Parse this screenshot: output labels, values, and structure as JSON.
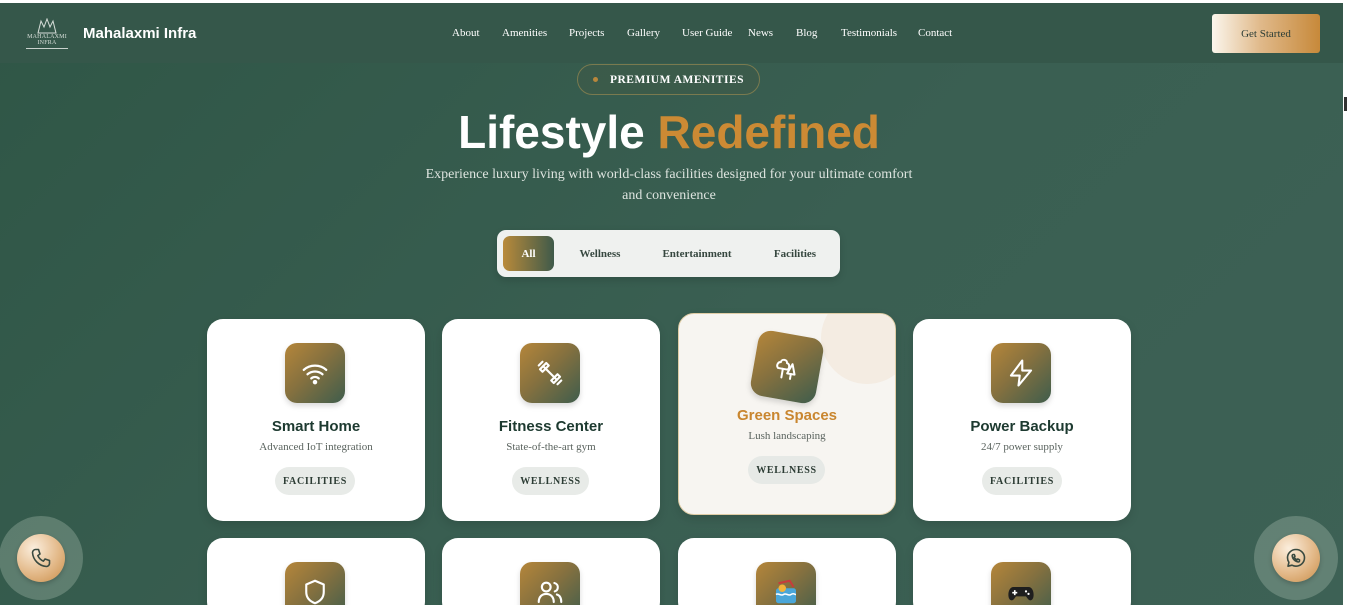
{
  "brand": {
    "logo_text_1": "MAHALAXMI",
    "logo_text_2": "INFRA",
    "name": "Mahalaxmi Infra"
  },
  "nav": {
    "links": [
      "About",
      "Amenities",
      "Projects",
      "Gallery",
      "User Guide",
      "News",
      "Blog",
      "Testimonials",
      "Contact"
    ],
    "cta": "Get Started"
  },
  "hero": {
    "pill": "PREMIUM AMENITIES",
    "title_white": "Lifestyle",
    "title_gold": "Redefined",
    "subtitle": "Experience luxury living with world-class facilities designed for your ultimate comfort and convenience"
  },
  "filters": {
    "tabs": [
      "All",
      "Wellness",
      "Entertainment",
      "Facilities"
    ],
    "active": "All"
  },
  "amenities": [
    {
      "title": "Smart Home",
      "desc": "Advanced IoT integration",
      "tag": "FACILITIES",
      "icon": "wifi-icon"
    },
    {
      "title": "Fitness Center",
      "desc": "State-of-the-art gym",
      "tag": "WELLNESS",
      "icon": "dumbbell-icon"
    },
    {
      "title": "Green Spaces",
      "desc": "Lush landscaping",
      "tag": "WELLNESS",
      "icon": "trees-icon"
    },
    {
      "title": "Power Backup",
      "desc": "24/7 power supply",
      "tag": "FACILITIES",
      "icon": "lightning-icon"
    }
  ],
  "amenities_row2_icons": [
    "shield-icon",
    "users-icon",
    "pool-icon",
    "gamepad-icon"
  ],
  "floating": {
    "left": "phone-icon",
    "right": "whatsapp-icon"
  },
  "colors": {
    "bg": "#35574a",
    "gold": "#cc8a34",
    "card": "#ffffff"
  }
}
